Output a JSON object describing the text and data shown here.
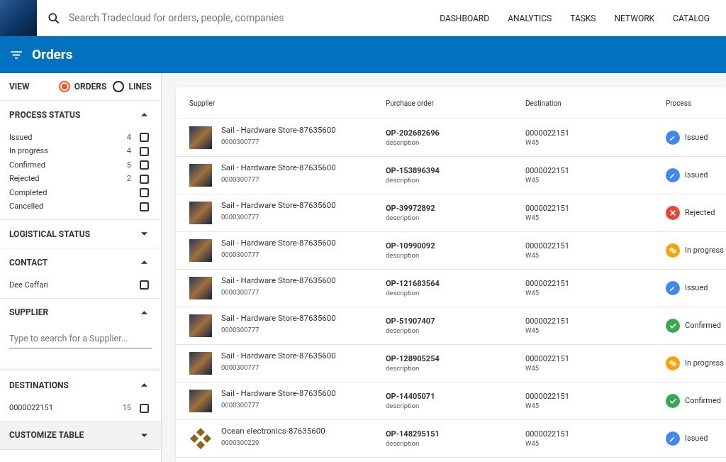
{
  "search": {
    "placeholder": "Search Tradecloud for orders, people, companies"
  },
  "nav": [
    "DASHBOARD",
    "ANALYTICS",
    "TASKS",
    "NETWORK",
    "CATALOG"
  ],
  "title": "Orders",
  "view": {
    "label": "VIEW",
    "options": [
      {
        "label": "ORDERS",
        "selected": true
      },
      {
        "label": "LINES",
        "selected": false
      }
    ]
  },
  "filters": [
    {
      "title": "PROCESS STATUS",
      "kind": "list",
      "expanded": true,
      "highlighted": false,
      "items": [
        {
          "label": "Issued",
          "count": "4",
          "checked": false
        },
        {
          "label": "In progress",
          "count": "4",
          "checked": false
        },
        {
          "label": "Confirmed",
          "count": "5",
          "checked": false
        },
        {
          "label": "Rejected",
          "count": "2",
          "checked": false
        },
        {
          "label": "Completed",
          "checked": false
        },
        {
          "label": "Cancelled",
          "checked": false
        }
      ]
    },
    {
      "title": "LOGISTICAL STATUS",
      "kind": "list",
      "expanded": false,
      "highlighted": false
    },
    {
      "title": "CONTACT",
      "kind": "list",
      "expanded": true,
      "highlighted": false,
      "items": [
        {
          "label": "Dee Caffari",
          "checked": false
        }
      ]
    },
    {
      "title": "SUPPLIER",
      "kind": "search",
      "expanded": true,
      "highlighted": false,
      "placeholder": "Type to search for a Supplier..."
    },
    {
      "title": "DESTINATIONS",
      "kind": "list",
      "expanded": true,
      "highlighted": false,
      "items": [
        {
          "label": "0000022151",
          "count": "15",
          "checked": false
        }
      ]
    },
    {
      "title": "CUSTOMIZE TABLE",
      "kind": "list",
      "expanded": false,
      "highlighted": true
    }
  ],
  "table": {
    "columns": [
      "Supplier",
      "Purchase order",
      "Destination",
      "Process"
    ],
    "rows": [
      {
        "logo": {
          "kind": "photo"
        },
        "supplier": "Sail - Hardware Store-87635600",
        "supplier_code": "0000300777",
        "order": "OP-202682696",
        "order_note": "description",
        "destination": "0000022151",
        "week": "W45",
        "status": {
          "kind": "issued",
          "label": "Issued"
        }
      },
      {
        "logo": {
          "kind": "photo"
        },
        "supplier": "Sail - Hardware Store-87635600",
        "supplier_code": "0000300777",
        "order": "OP-153896394",
        "order_note": "description",
        "destination": "0000022151",
        "week": "W45",
        "status": {
          "kind": "issued",
          "label": "Issued"
        }
      },
      {
        "logo": {
          "kind": "photo"
        },
        "supplier": "Sail - Hardware Store-87635600",
        "supplier_code": "0000300777",
        "order": "OP-39972892",
        "order_note": "description",
        "destination": "0000022151",
        "week": "W45",
        "status": {
          "kind": "rejected",
          "label": "Rejected"
        }
      },
      {
        "logo": {
          "kind": "photo"
        },
        "supplier": "Sail - Hardware Store-87635600",
        "supplier_code": "0000300777",
        "order": "OP-10990092",
        "order_note": "description",
        "destination": "0000022151",
        "week": "W45",
        "status": {
          "kind": "in_progress",
          "label": "In progress"
        }
      },
      {
        "logo": {
          "kind": "photo"
        },
        "supplier": "Sail - Hardware Store-87635600",
        "supplier_code": "0000300777",
        "order": "OP-121683564",
        "order_note": "description",
        "destination": "0000022151",
        "week": "W45",
        "status": {
          "kind": "issued",
          "label": "Issued"
        }
      },
      {
        "logo": {
          "kind": "photo"
        },
        "supplier": "Sail - Hardware Store-87635600",
        "supplier_code": "0000300777",
        "order": "OP-51907407",
        "order_note": "description",
        "destination": "0000022151",
        "week": "W45",
        "status": {
          "kind": "confirmed",
          "label": "Confirmed"
        }
      },
      {
        "logo": {
          "kind": "photo"
        },
        "supplier": "Sail - Hardware Store-87635600",
        "supplier_code": "0000300777",
        "order": "OP-128905254",
        "order_note": "description",
        "destination": "0000022151",
        "week": "W45",
        "status": {
          "kind": "in_progress",
          "label": "In progress"
        }
      },
      {
        "logo": {
          "kind": "photo"
        },
        "supplier": "Sail - Hardware Store-87635600",
        "supplier_code": "0000300777",
        "order": "OP-14405071",
        "order_note": "description",
        "destination": "0000022151",
        "week": "W45",
        "status": {
          "kind": "confirmed",
          "label": "Confirmed"
        }
      },
      {
        "logo": {
          "kind": "diamonds"
        },
        "supplier": "Ocean electronics-87635600",
        "supplier_code": "0000300229",
        "order": "OP-148295151",
        "order_note": "description",
        "destination": "0000022151",
        "week": "W45",
        "status": {
          "kind": "issued",
          "label": "Issued"
        }
      }
    ]
  }
}
